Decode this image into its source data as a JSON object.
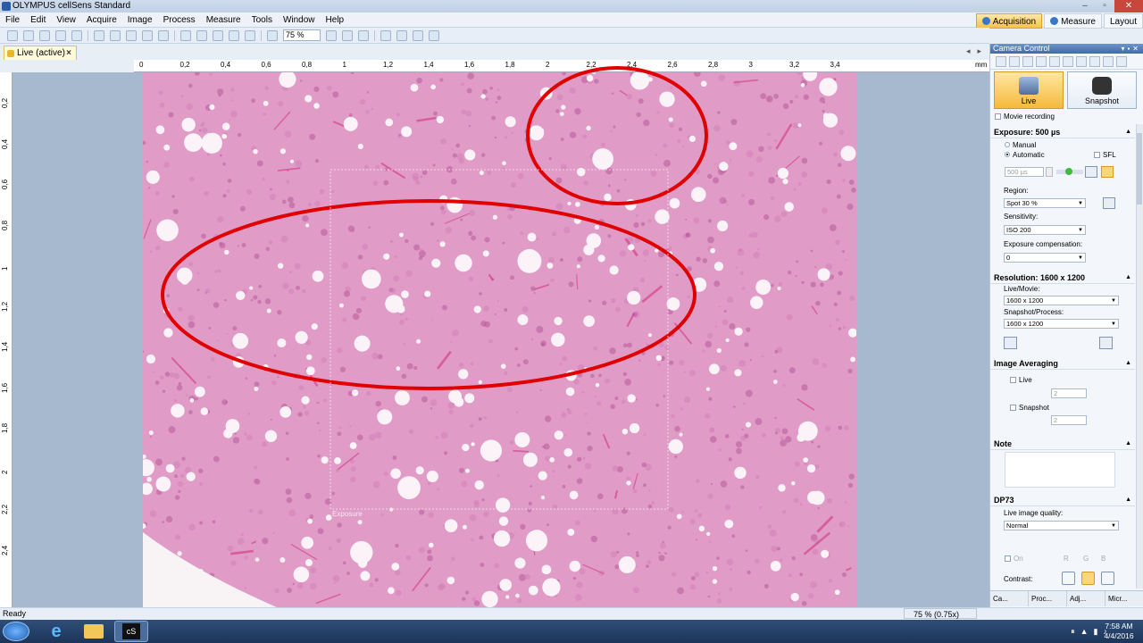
{
  "window": {
    "title": "OLYMPUS cellSens Standard"
  },
  "menu": [
    "File",
    "Edit",
    "View",
    "Acquire",
    "Image",
    "Process",
    "Measure",
    "Tools",
    "Window",
    "Help"
  ],
  "ribbon_tabs": [
    {
      "label": "Acquisition",
      "active": true
    },
    {
      "label": "Measure",
      "active": false
    },
    {
      "label": "Layout",
      "active": false
    }
  ],
  "toolbar": {
    "zoom_value": "75 %"
  },
  "document_tab": {
    "label": "Live (active)",
    "close": "×"
  },
  "ruler": {
    "unit": "mm",
    "h_ticks": [
      "0",
      "0,2",
      "0,4",
      "0,6",
      "0,8",
      "1",
      "1,2",
      "1,4",
      "1,6",
      "1,8",
      "2",
      "2,2",
      "2,4",
      "2,6",
      "2,8",
      "3",
      "3,2",
      "3,4"
    ],
    "v_ticks": [
      "0,2",
      "0,4",
      "0,6",
      "0,8",
      "1",
      "1,2",
      "1,4",
      "1,6",
      "1,8",
      "2",
      "2,2",
      "2,4"
    ]
  },
  "image": {
    "roi_label": "Exposure",
    "annotation_color": "#e00000",
    "tissue_color": "#e09cc6"
  },
  "camera_panel": {
    "title": "Camera Control",
    "live_label": "Live",
    "snapshot_label": "Snapshot",
    "movie_recording": "Movie recording",
    "exposure": {
      "header": "Exposure: 500 µs",
      "manual": "Manual",
      "automatic": "Automatic",
      "sfl": "SFL",
      "value": "500 µs",
      "region_label": "Region:",
      "region_value": "Spot 30 %",
      "sensitivity_label": "Sensitivity:",
      "sensitivity_value": "ISO 200",
      "comp_label": "Exposure compensation:",
      "comp_value": "0"
    },
    "resolution": {
      "header": "Resolution: 1600 x 1200",
      "live_label": "Live/Movie:",
      "live_value": "1600 x 1200",
      "snap_label": "Snapshot/Process:",
      "snap_value": "1600 x 1200"
    },
    "averaging": {
      "header": "Image Averaging",
      "live": "Live",
      "snapshot": "Snapshot",
      "live_frames": "2",
      "snap_frames": "2"
    },
    "note": {
      "header": "Note"
    },
    "dp73": {
      "header": "DP73",
      "quality_label": "Live image quality:",
      "quality_value": "Normal",
      "on_label": "On",
      "r": "R",
      "g": "G",
      "b": "B",
      "contrast_label": "Contrast:"
    },
    "tabs": [
      "Ca...",
      "Proc...",
      "Adj...",
      "Micr..."
    ]
  },
  "status": {
    "left": "Ready",
    "zoom": "75 % (0.75x)"
  },
  "taskbar": {
    "time": "7:58 AM",
    "date": "4/4/2016"
  }
}
